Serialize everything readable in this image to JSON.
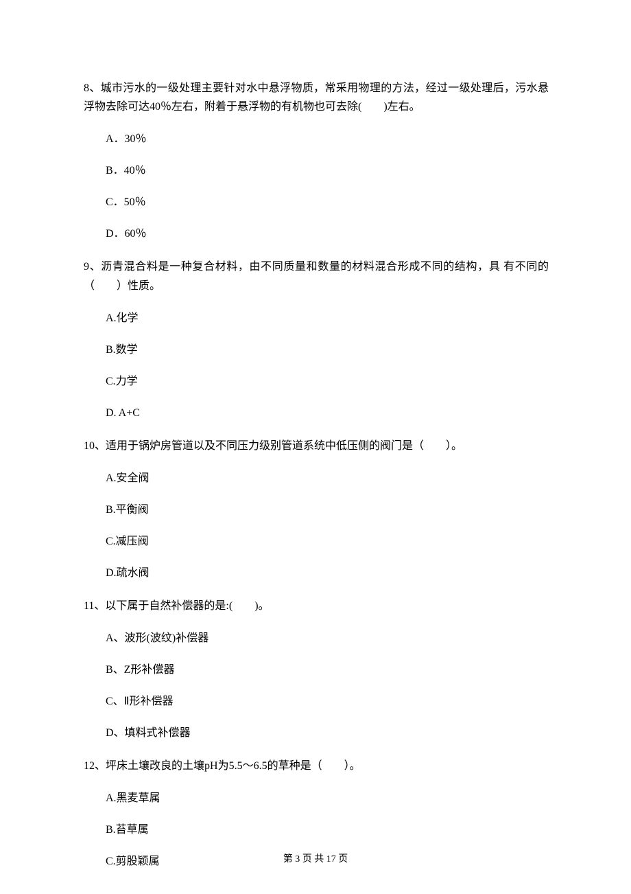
{
  "questions": [
    {
      "number": "8、",
      "text": "城市污水的一级处理主要针对水中悬浮物质，常采用物理的方法，经过一级处理后，污水悬浮物去除可达40％左右，附着于悬浮物的有机物也可去除(　　)左右。",
      "options": [
        "A．30％",
        "B．40％",
        "C．50％",
        "D．60％"
      ]
    },
    {
      "number": "9、",
      "text": "沥青混合料是一种复合材料，由不同质量和数量的材料混合形成不同的结构，具 有不同的（　　）性质。",
      "options": [
        "A.化学",
        "B.数学",
        "C.力学",
        "D. A+C"
      ]
    },
    {
      "number": "10、",
      "text": "适用于锅炉房管道以及不同压力级别管道系统中低压侧的阀门是（　　）。",
      "options": [
        "A.安全阀",
        "B.平衡阀",
        "C.减压阀",
        "D.疏水阀"
      ]
    },
    {
      "number": "11、",
      "text": "以下属于自然补偿器的是:(　　)。",
      "options": [
        "A、波形(波纹)补偿器",
        "B、Z形补偿器",
        "C、Ⅱ形补偿器",
        "D、填料式补偿器"
      ]
    },
    {
      "number": "12、",
      "text": "坪床土壤改良的土壤pH为5.5～6.5的草种是（　　）。",
      "options": [
        "A.黑麦草属",
        "B.苔草属",
        "C.剪股颖属"
      ]
    }
  ],
  "footer": "第 3 页 共 17 页"
}
